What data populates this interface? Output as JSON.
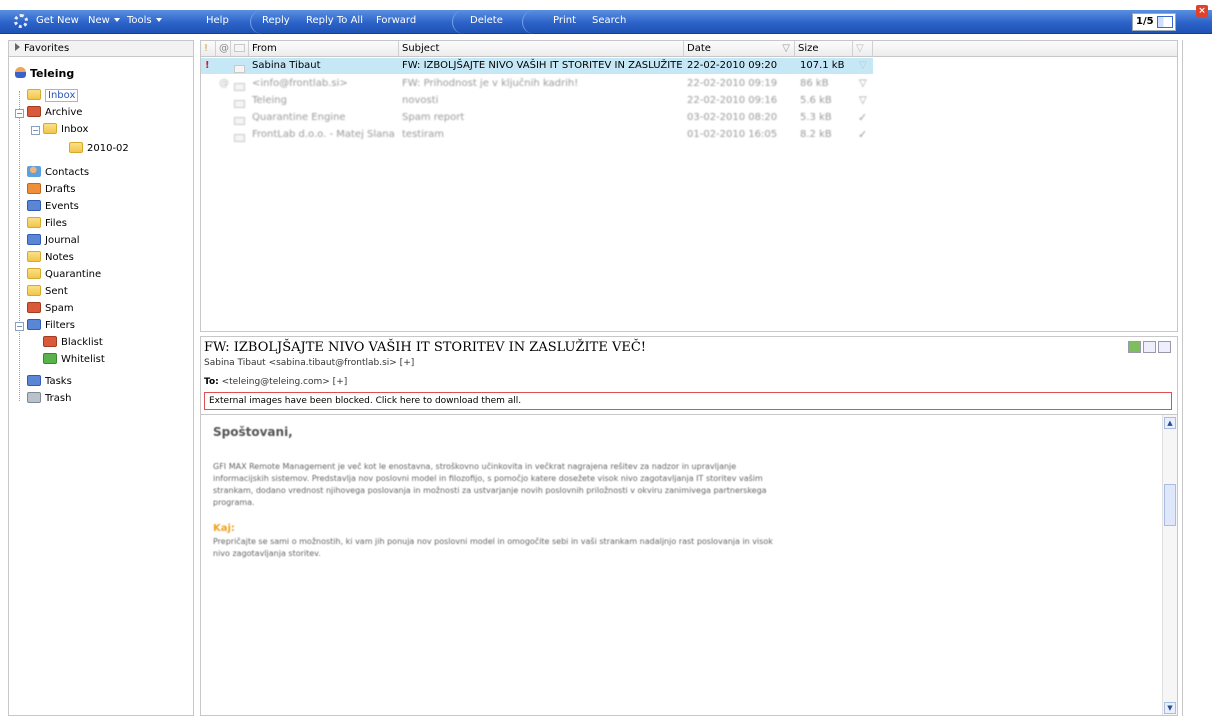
{
  "toolbar": {
    "get_new": "Get New",
    "new": "New",
    "tools": "Tools",
    "help": "Help",
    "reply": "Reply",
    "reply_all": "Reply To All",
    "forward": "Forward",
    "delete": "Delete",
    "print": "Print",
    "search": "Search",
    "pager": "1/5"
  },
  "sidebar": {
    "favorites": "Favorites",
    "account": "Teleing",
    "inbox": "Inbox",
    "archive": "Archive",
    "archive_inbox": "Inbox",
    "archive_sub": "2010-02",
    "contacts": "Contacts",
    "drafts": "Drafts",
    "events": "Events",
    "files": "Files",
    "journal": "Journal",
    "notes": "Notes",
    "quarantine": "Quarantine",
    "sent": "Sent",
    "spam": "Spam",
    "filters": "Filters",
    "blacklist": "Blacklist",
    "whitelist": "Whitelist",
    "tasks": "Tasks",
    "trash": "Trash"
  },
  "list": {
    "columns": {
      "priority": "!",
      "attachment": "@",
      "from": "From",
      "subject": "Subject",
      "date": "Date",
      "size": "Size"
    },
    "rows": [
      {
        "from": "Sabina Tibaut",
        "subject": "FW: IZBOLJŠAJTE NIVO VAŠIH IT STORITEV IN ZASLUŽITE VEČ!",
        "date": "22-02-2010 09:20",
        "size": "107.1 kB"
      },
      {
        "from": "<info@frontlab.si>",
        "subject": "FW: Prihodnost je v ključnih kadrih!",
        "date": "22-02-2010 09:19",
        "size": "86 kB"
      },
      {
        "from": "Teleing",
        "subject": "novosti",
        "date": "22-02-2010 09:16",
        "size": "5.6 kB"
      },
      {
        "from": "Quarantine Engine",
        "subject": "Spam report",
        "date": "03-02-2010 08:20",
        "size": "5.3 kB"
      },
      {
        "from": "FrontLab d.o.o. - Matej Slana",
        "subject": "testiram",
        "date": "01-02-2010 16:05",
        "size": "8.2 kB"
      }
    ]
  },
  "preview": {
    "subject": "FW: IZBOLJŠAJTE NIVO VAŠIH IT STORITEV IN ZASLUŽITE VEČ!",
    "from": "Sabina Tibaut <sabina.tibaut@frontlab.si> [+]",
    "to_label": "To:",
    "to": "<teleing@teleing.com> [+]",
    "notice": "External images have been blocked. Click here to download them all.",
    "greeting": "Spoštovani,",
    "para1": "GFI MAX Remote Management je več kot le enostavna, stroškovno učinkovita in večkrat nagrajena rešitev za nadzor in upravljanje informacijskih sistemov. Predstavlja nov poslovni model in filozofijo, s pomočjo katere dosežete visok nivo zagotavljanja IT storitev vašim strankam, dodano vrednost njihovega poslovanja in možnosti za ustvarjanje novih poslovnih priložnosti v okviru zanimivega partnerskega programa.",
    "kaj": "Kaj:",
    "para2": "Prepričajte se sami o možnostih, ki vam jih ponuja nov poslovni model in omogočite sebi in vaši strankam nadaljnjo rast poslovanja in visok nivo zagotavljanja storitev."
  }
}
